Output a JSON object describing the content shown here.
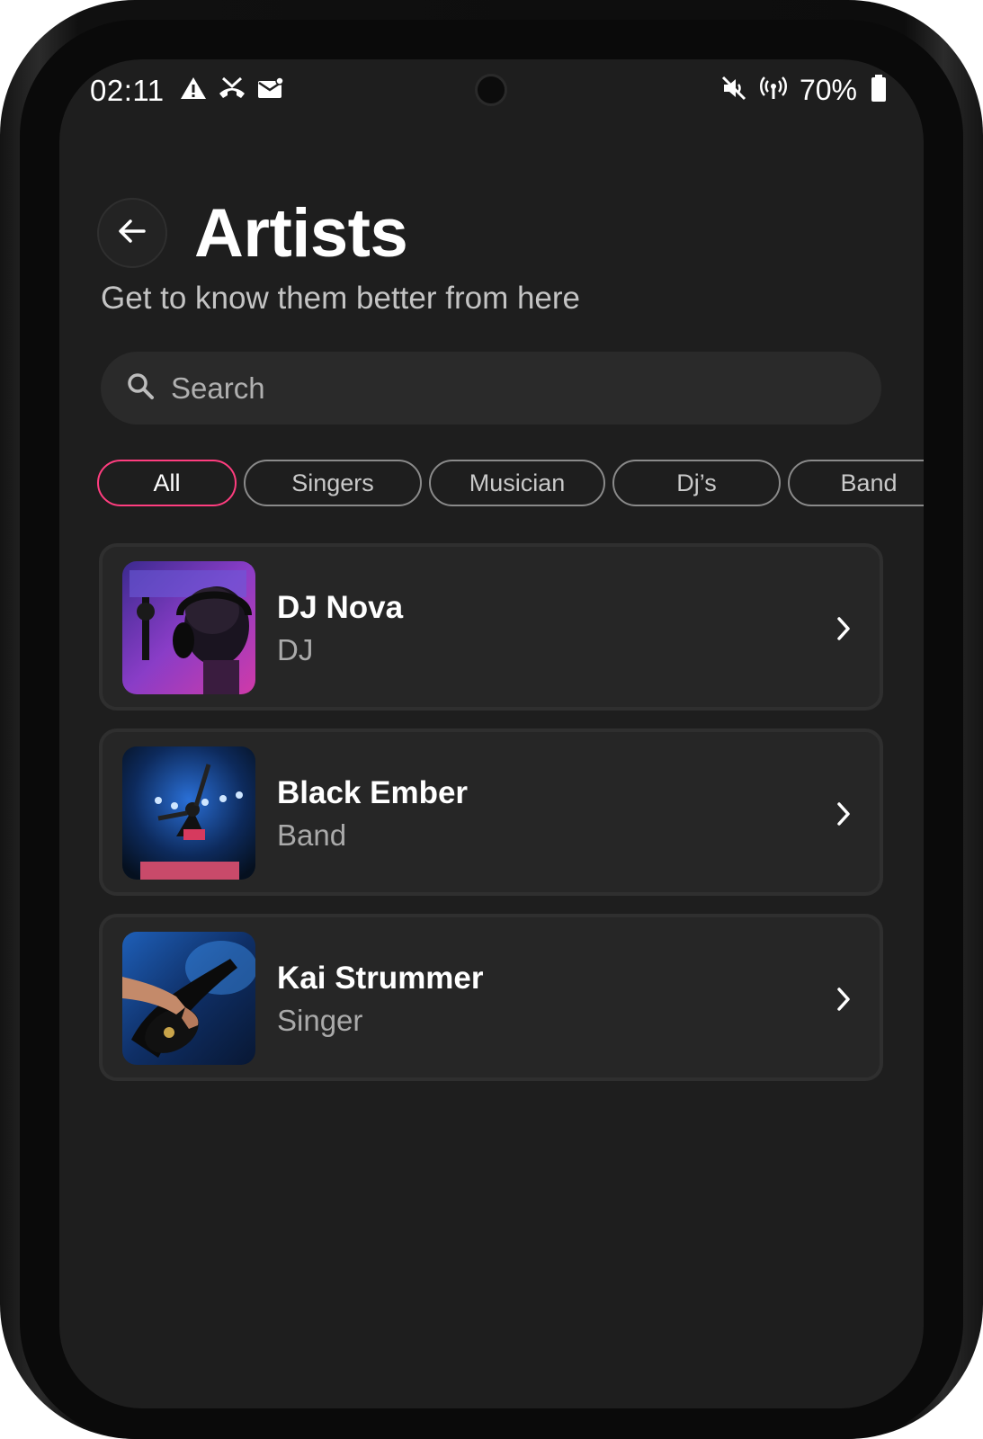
{
  "status_bar": {
    "time": "02:11",
    "battery": "70%",
    "left_icons": [
      "warning-icon",
      "missed-call-icon",
      "mail-icon"
    ],
    "right_icons": [
      "mute-icon",
      "hotspot-icon",
      "battery-icon"
    ]
  },
  "header": {
    "title": "Artists",
    "subtitle": "Get to know them better from here"
  },
  "search": {
    "placeholder": "Search"
  },
  "filters": [
    {
      "label": "All",
      "active": true
    },
    {
      "label": "Singers",
      "active": false
    },
    {
      "label": "Musician",
      "active": false
    },
    {
      "label": "Dj’s",
      "active": false
    },
    {
      "label": "Band",
      "active": false
    }
  ],
  "artists": [
    {
      "name": "DJ Nova",
      "role": "DJ"
    },
    {
      "name": "Black Ember",
      "role": "Band"
    },
    {
      "name": "Kai Strummer",
      "role": "Singer"
    }
  ],
  "colors": {
    "accent": "#ff3d7f",
    "background": "#1e1e1e",
    "card": "#262626"
  }
}
